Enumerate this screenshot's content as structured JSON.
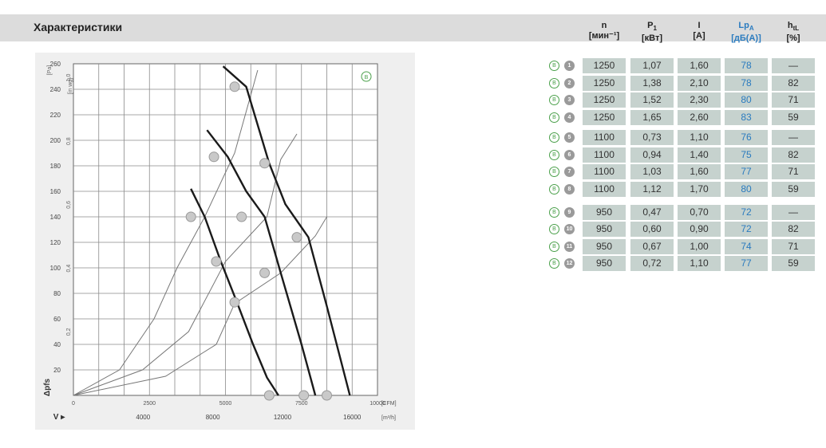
{
  "header": {
    "title": "Характеристики"
  },
  "table": {
    "columns": [
      {
        "sym": "n",
        "unit": "[мин⁻¹]",
        "blue": false
      },
      {
        "sym": "P",
        "sub": "1",
        "unit": "[кВт]",
        "blue": false
      },
      {
        "sym": "I",
        "unit": "[A]",
        "blue": false
      },
      {
        "sym": "Lp",
        "sub": "A",
        "unit": "[дБ(A)]",
        "blue": true
      },
      {
        "sym": "h",
        "sub": "tL",
        "unit": "[%]",
        "blue": false
      }
    ],
    "rows": [
      {
        "badge": "B",
        "num": "1",
        "n": "1250",
        "p1": "1,07",
        "i": "1,60",
        "lpa": "78",
        "h": "—"
      },
      {
        "badge": "B",
        "num": "2",
        "n": "1250",
        "p1": "1,38",
        "i": "2,10",
        "lpa": "78",
        "h": "82"
      },
      {
        "badge": "B",
        "num": "3",
        "n": "1250",
        "p1": "1,52",
        "i": "2,30",
        "lpa": "80",
        "h": "71"
      },
      {
        "badge": "B",
        "num": "4",
        "n": "1250",
        "p1": "1,65",
        "i": "2,60",
        "lpa": "83",
        "h": "59"
      },
      {
        "badge": "B",
        "num": "5",
        "n": "1100",
        "p1": "0,73",
        "i": "1,10",
        "lpa": "76",
        "h": "—"
      },
      {
        "badge": "B",
        "num": "6",
        "n": "1100",
        "p1": "0,94",
        "i": "1,40",
        "lpa": "75",
        "h": "82"
      },
      {
        "badge": "B",
        "num": "7",
        "n": "1100",
        "p1": "1,03",
        "i": "1,60",
        "lpa": "77",
        "h": "71"
      },
      {
        "badge": "B",
        "num": "8",
        "n": "1100",
        "p1": "1,12",
        "i": "1,70",
        "lpa": "80",
        "h": "59"
      },
      {
        "badge": "B",
        "num": "9",
        "n": "950",
        "p1": "0,47",
        "i": "0,70",
        "lpa": "72",
        "h": "—"
      },
      {
        "badge": "B",
        "num": "10",
        "n": "950",
        "p1": "0,60",
        "i": "0,90",
        "lpa": "72",
        "h": "82"
      },
      {
        "badge": "B",
        "num": "11",
        "n": "950",
        "p1": "0,67",
        "i": "1,00",
        "lpa": "74",
        "h": "71"
      },
      {
        "badge": "B",
        "num": "12",
        "n": "950",
        "p1": "0,72",
        "i": "1,10",
        "lpa": "77",
        "h": "59"
      }
    ]
  },
  "chart_data": {
    "type": "line",
    "title": "",
    "badge": "B",
    "xlabel": "V",
    "ylabel": "Δpfs",
    "x_unit": "[CFM]",
    "x_unit_alt": "[m³/h]",
    "y_unit": "[Pa]",
    "y_unit_alt": "[in wg]",
    "xlim": [
      0,
      13200
    ],
    "ylim": [
      0,
      260
    ],
    "x_ticks": [
      "0",
      "2500",
      "5000",
      "7500",
      "10000"
    ],
    "x_ticks_alt": [
      "4000",
      "8000",
      "12000",
      "16000"
    ],
    "y_ticks": [
      "20",
      "40",
      "60",
      "80",
      "100",
      "120",
      "140",
      "160",
      "180",
      "200",
      "220",
      "240",
      "260"
    ],
    "y_ticks_alt": [
      "0,2",
      "0,4",
      "0,6",
      "0,8",
      "1,0"
    ],
    "grid": true,
    "speed_curves": [
      {
        "name": "1250",
        "x": [
          6500,
          7500,
          8500,
          9200,
          10200,
          11000,
          12000
        ],
        "y": [
          258,
          242,
          182,
          150,
          124,
          70,
          0
        ]
      },
      {
        "name": "1100",
        "x": [
          5800,
          6700,
          7500,
          8300,
          9000,
          9900,
          10500
        ],
        "y": [
          208,
          187,
          160,
          140,
          96,
          40,
          0
        ]
      },
      {
        "name": "1250_low",
        "x": [
          5100,
          5700,
          6400,
          7100,
          7800,
          8400,
          8900
        ],
        "y": [
          162,
          140,
          105,
          73,
          40,
          14,
          0
        ]
      }
    ],
    "system_curves": [
      {
        "name": "h82",
        "x": [
          0,
          2000,
          3500,
          4500,
          5700,
          7000,
          8000
        ],
        "y": [
          0,
          20,
          60,
          100,
          140,
          190,
          255
        ]
      },
      {
        "name": "h71",
        "x": [
          0,
          3000,
          5000,
          6600,
          8400,
          9000,
          9700
        ],
        "y": [
          0,
          20,
          50,
          105,
          140,
          185,
          205
        ]
      },
      {
        "name": "h59",
        "x": [
          0,
          4000,
          6200,
          7000,
          9000,
          10500,
          11000
        ],
        "y": [
          0,
          15,
          40,
          72,
          96,
          125,
          140
        ]
      }
    ],
    "operating_points": [
      {
        "label": "1",
        "x": 7000,
        "y": 242
      },
      {
        "label": "2",
        "x": 8300,
        "y": 182
      },
      {
        "label": "3",
        "x": 9700,
        "y": 124
      },
      {
        "label": "4",
        "x": 11000,
        "y": 0
      },
      {
        "label": "5",
        "x": 6100,
        "y": 187
      },
      {
        "label": "6",
        "x": 7300,
        "y": 140
      },
      {
        "label": "7",
        "x": 8300,
        "y": 96
      },
      {
        "label": "8",
        "x": 10000,
        "y": 0
      },
      {
        "label": "9",
        "x": 5100,
        "y": 140
      },
      {
        "label": "10",
        "x": 6200,
        "y": 105
      },
      {
        "label": "11",
        "x": 7000,
        "y": 73
      },
      {
        "label": "12",
        "x": 8500,
        "y": 0
      }
    ]
  }
}
